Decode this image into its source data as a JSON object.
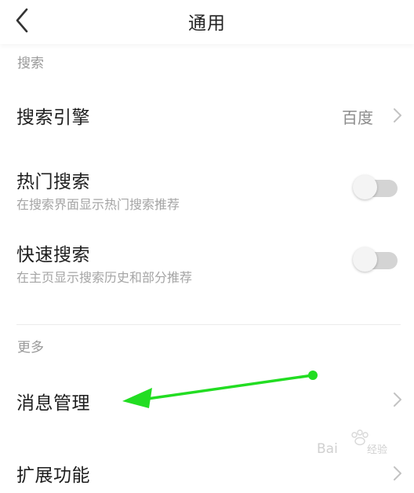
{
  "header": {
    "title": "通用",
    "back_icon": "chevron-left-icon"
  },
  "sections": {
    "search": {
      "label": "搜索",
      "engine": {
        "title": "搜索引擎",
        "value": "百度"
      },
      "hot": {
        "title": "热门搜索",
        "subtitle": "在搜索界面显示热门搜索推荐",
        "enabled": false
      },
      "quick": {
        "title": "快速搜索",
        "subtitle": "在主页显示搜索历史和部分推荐",
        "enabled": false
      }
    },
    "more": {
      "label": "更多",
      "messages": {
        "title": "消息管理"
      },
      "extensions": {
        "title": "扩展功能"
      }
    }
  },
  "annotation": {
    "color": "#22dd22"
  },
  "colors": {
    "text_primary": "#1e1e1e",
    "text_secondary": "#9a9a9a",
    "toggle_off_track": "#d4d4d4",
    "toggle_knob": "#f4f4f4"
  }
}
